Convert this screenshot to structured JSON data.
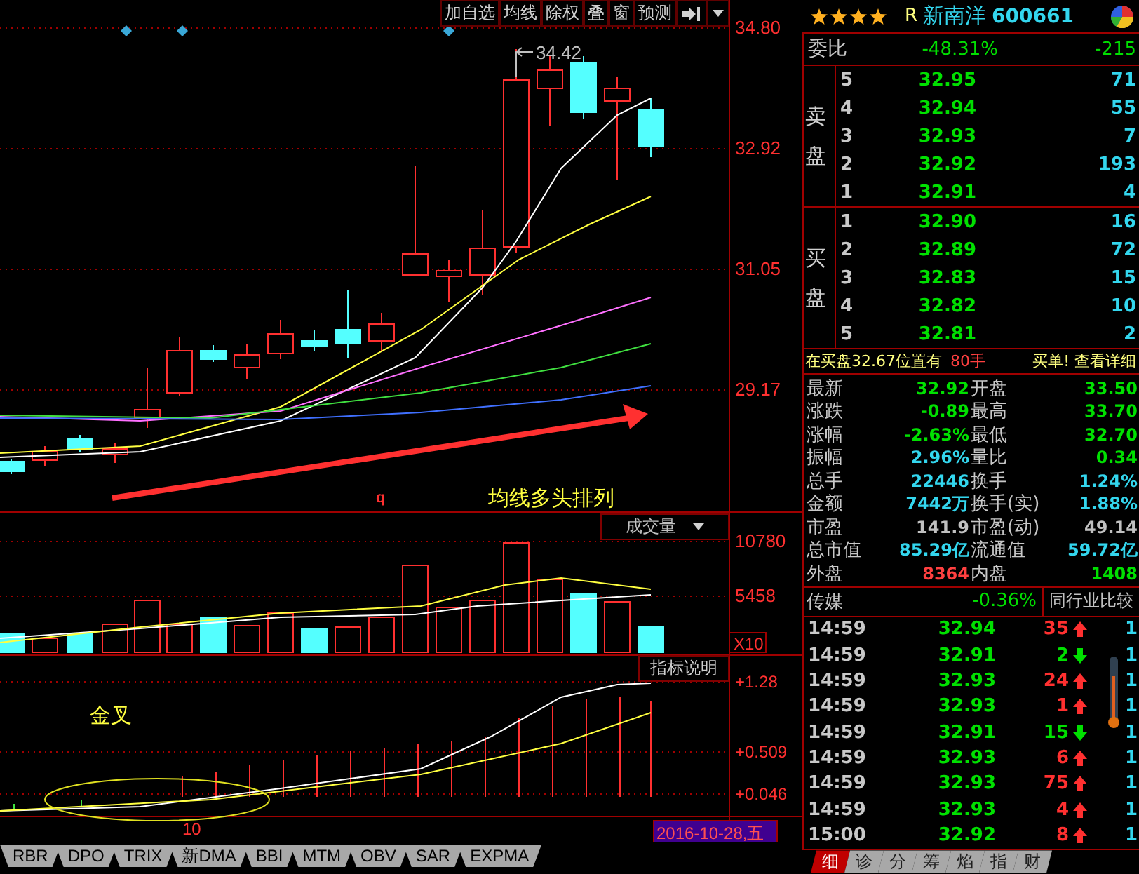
{
  "toolbar": {
    "buttons": [
      "加自选",
      "均线",
      "除权",
      "叠",
      "窗",
      "预测"
    ]
  },
  "price_chart": {
    "axis": [
      "34.80",
      "32.92",
      "31.05",
      "29.17"
    ],
    "peak_label": "34.42",
    "marker": "q",
    "caption": "均线多头排列"
  },
  "volume_pane": {
    "dropdown": "成交量",
    "axis": [
      "10780",
      "5458"
    ],
    "multiplier": "X10"
  },
  "macd_pane": {
    "button": "指标说明",
    "caption": "金叉",
    "axis": [
      "+1.28",
      "+0.509",
      "+0.046"
    ],
    "x_label": "10",
    "date": "2016-10-28,五"
  },
  "indicator_tabs": [
    "RBR",
    "DPO",
    "TRIX",
    "新DMA",
    "BBI",
    "MTM",
    "OBV",
    "SAR",
    "EXPMA"
  ],
  "quote": {
    "stars": 4,
    "prefix": "R",
    "name": "新南洋",
    "code": "600661"
  },
  "weibi": {
    "label": "委比",
    "percent": "-48.31%",
    "diff": "-215"
  },
  "sell": {
    "label": "卖盘",
    "levels": [
      {
        "level": "5",
        "price": "32.95",
        "volume": "71"
      },
      {
        "level": "4",
        "price": "32.94",
        "volume": "55"
      },
      {
        "level": "3",
        "price": "32.93",
        "volume": "7"
      },
      {
        "level": "2",
        "price": "32.92",
        "volume": "193"
      },
      {
        "level": "1",
        "price": "32.91",
        "volume": "4"
      }
    ]
  },
  "buy": {
    "label": "买盘",
    "levels": [
      {
        "level": "1",
        "price": "32.90",
        "volume": "16"
      },
      {
        "level": "2",
        "price": "32.89",
        "volume": "72"
      },
      {
        "level": "3",
        "price": "32.83",
        "volume": "15"
      },
      {
        "level": "4",
        "price": "32.82",
        "volume": "10"
      },
      {
        "level": "5",
        "price": "32.81",
        "volume": "2"
      }
    ]
  },
  "notice": {
    "text": "在买盘32.67位置有",
    "amount": "80手",
    "link": "买单! 查看详细"
  },
  "stats": [
    {
      "label": "最新",
      "value": "32.92",
      "color": "#00e000"
    },
    {
      "label": "开盘",
      "value": "33.50",
      "color": "#00e000"
    },
    {
      "label": "涨跌",
      "value": "-0.89",
      "color": "#00e000"
    },
    {
      "label": "最高",
      "value": "33.70",
      "color": "#00e000"
    },
    {
      "label": "涨幅",
      "value": "-2.63%",
      "color": "#00e000"
    },
    {
      "label": "最低",
      "value": "32.70",
      "color": "#00e000"
    },
    {
      "label": "振幅",
      "value": "2.96%",
      "color": "#33d6ee"
    },
    {
      "label": "量比",
      "value": "0.34",
      "color": "#00e000"
    },
    {
      "label": "总手",
      "value": "22446",
      "color": "#33d6ee"
    },
    {
      "label": "换手",
      "value": "1.24%",
      "color": "#33d6ee"
    },
    {
      "label": "金额",
      "value": "7442万",
      "color": "#33d6ee"
    },
    {
      "label": "换手(实)",
      "value": "1.88%",
      "color": "#33d6ee"
    },
    {
      "label": "市盈",
      "value": "141.9",
      "color": "#c0c0c0"
    },
    {
      "label": "市盈(动)",
      "value": "49.14",
      "color": "#c0c0c0"
    },
    {
      "label": "总市值",
      "value": "85.29亿",
      "color": "#33d6ee"
    },
    {
      "label": "流通值",
      "value": "59.72亿",
      "color": "#33d6ee"
    },
    {
      "label": "外盘",
      "value": "8364",
      "color": "#ff4040"
    },
    {
      "label": "内盘",
      "value": "1408",
      "color": "#00e000"
    }
  ],
  "sector": {
    "name": "传媒",
    "change": "-0.36%",
    "button": "同行业比较"
  },
  "ticks": [
    {
      "time": "14:59",
      "price": "32.94",
      "volume": "35",
      "rising": true,
      "column_5": "1"
    },
    {
      "time": "14:59",
      "price": "32.91",
      "volume": "2",
      "rising": false,
      "column_5": "1"
    },
    {
      "time": "14:59",
      "price": "32.93",
      "volume": "24",
      "rising": true,
      "column_5": "1"
    },
    {
      "time": "14:59",
      "price": "32.93",
      "volume": "1",
      "rising": true,
      "column_5": "1"
    },
    {
      "time": "14:59",
      "price": "32.91",
      "volume": "15",
      "rising": false,
      "column_5": "1"
    },
    {
      "time": "14:59",
      "price": "32.93",
      "volume": "6",
      "rising": true,
      "column_5": "1"
    },
    {
      "time": "14:59",
      "price": "32.93",
      "volume": "75",
      "rising": true,
      "column_5": "1"
    },
    {
      "time": "14:59",
      "price": "32.93",
      "volume": "4",
      "rising": true,
      "column_5": "1"
    },
    {
      "time": "15:00",
      "price": "32.92",
      "volume": "8",
      "rising": true,
      "column_5": "1"
    }
  ],
  "bottom_tabs": [
    {
      "label": "细",
      "selected": true
    },
    {
      "label": "诊",
      "selected": false
    },
    {
      "label": "分",
      "selected": false
    },
    {
      "label": "筹",
      "selected": false
    },
    {
      "label": "焰",
      "selected": false
    },
    {
      "label": "指",
      "selected": false
    },
    {
      "label": "财",
      "selected": false
    }
  ]
}
